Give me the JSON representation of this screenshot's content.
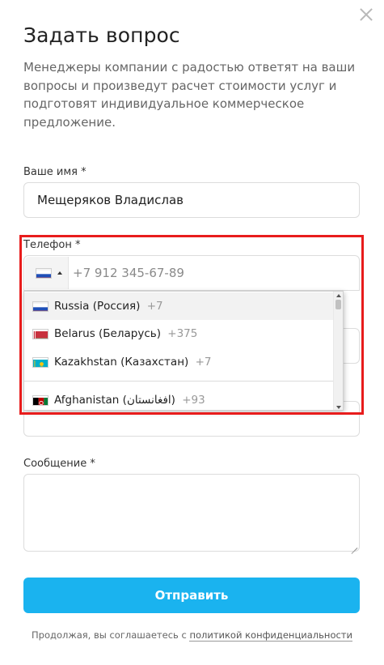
{
  "modal": {
    "title": "Задать вопрос",
    "description": "Менеджеры компании с радостью ответят на ваши вопросы и произведут расчет стоимости услуг и подготовят индивидуальное коммерческое предложение.",
    "close_icon": "close-icon"
  },
  "form": {
    "name_label": "Ваше имя *",
    "name_value": "Мещеряков Владислав",
    "phone_label": "Телефон *",
    "phone_placeholder": "+7 912 345-67-89",
    "message_label": "Сообщение *",
    "submit_label": "Отправить",
    "consent_text": "Продолжая, вы соглашаетесь с ",
    "consent_link": "политикой конфиденциальности"
  },
  "phone_dropdown": {
    "selected_flag": "flag-ru-icon",
    "items": [
      {
        "name": "Russia (Россия)",
        "code": "+7",
        "flag": "flag-ru-icon"
      },
      {
        "name": "Belarus (Беларусь)",
        "code": "+375",
        "flag": "flag-by-icon"
      },
      {
        "name": "Kazakhstan (Казахстан)",
        "code": "+7",
        "flag": "flag-kz-icon"
      },
      {
        "name": "Afghanistan (‫افغانستان‬‎)",
        "code": "+93",
        "flag": "flag-af-icon"
      }
    ]
  },
  "colors": {
    "accent": "#1ab3ef",
    "highlight": "#e81c1c"
  }
}
